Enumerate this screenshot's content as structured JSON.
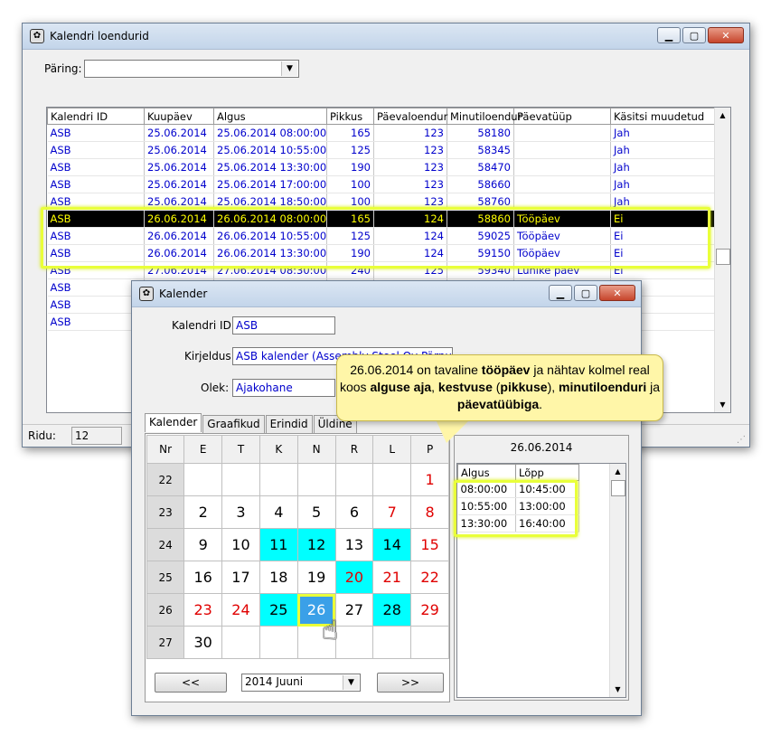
{
  "main_window": {
    "title": "Kalendri loendurid",
    "query_label": "Päring:",
    "query_value": "",
    "columns": [
      "Kalendri ID",
      "Kuupäev",
      "Algus",
      "Pikkus",
      "Päevaloendur",
      "Minutiloendur",
      "Päevatüüp",
      "Käsitsi muudetud"
    ],
    "rows": [
      [
        "ASB",
        "25.06.2014",
        "25.06.2014 08:00:00",
        "165",
        "123",
        "58180",
        "",
        "Jah"
      ],
      [
        "ASB",
        "25.06.2014",
        "25.06.2014 10:55:00",
        "125",
        "123",
        "58345",
        "",
        "Jah"
      ],
      [
        "ASB",
        "25.06.2014",
        "25.06.2014 13:30:00",
        "190",
        "123",
        "58470",
        "",
        "Jah"
      ],
      [
        "ASB",
        "25.06.2014",
        "25.06.2014 17:00:00",
        "100",
        "123",
        "58660",
        "",
        "Jah"
      ],
      [
        "ASB",
        "25.06.2014",
        "25.06.2014 18:50:00",
        "100",
        "123",
        "58760",
        "",
        "Jah"
      ],
      [
        "ASB",
        "26.06.2014",
        "26.06.2014 08:00:00",
        "165",
        "124",
        "58860",
        "Tööpäev",
        "Ei"
      ],
      [
        "ASB",
        "26.06.2014",
        "26.06.2014 10:55:00",
        "125",
        "124",
        "59025",
        "Tööpäev",
        "Ei"
      ],
      [
        "ASB",
        "26.06.2014",
        "26.06.2014 13:30:00",
        "190",
        "124",
        "59150",
        "Tööpäev",
        "Ei"
      ],
      [
        "ASB",
        "27.06.2014",
        "27.06.2014 08:30:00",
        "240",
        "125",
        "59340",
        "Lühike päev",
        "Ei"
      ],
      [
        "ASB",
        "",
        "",
        "",
        "",
        "",
        "",
        ""
      ],
      [
        "ASB",
        "",
        "",
        "",
        "",
        "",
        "",
        ""
      ],
      [
        "ASB",
        "",
        "",
        "",
        "",
        "",
        "",
        ""
      ]
    ],
    "rows_label": "Ridu:",
    "rows_count": "12"
  },
  "calendar_window": {
    "title": "Kalender",
    "id_label": "Kalendri ID:",
    "id_value": "ASB",
    "desc_label": "Kirjeldus:",
    "desc_value": "ASB kalender (Assembly Steel Oy Pärnu)",
    "status_label": "Olek:",
    "status_value": "Ajakohane",
    "tabs": [
      "Kalender",
      "Graafikud",
      "Erindid",
      "Üldine"
    ],
    "weekday_headers": [
      "Nr",
      "E",
      "T",
      "K",
      "N",
      "R",
      "L",
      "P"
    ],
    "weeks": [
      {
        "nr": "22",
        "days": [
          "",
          "",
          "",
          "",
          "",
          "",
          "1"
        ]
      },
      {
        "nr": "23",
        "days": [
          "2",
          "3",
          "4",
          "5",
          "6",
          "7",
          "8"
        ]
      },
      {
        "nr": "24",
        "days": [
          "9",
          "10",
          "11",
          "12",
          "13",
          "14",
          "15"
        ]
      },
      {
        "nr": "25",
        "days": [
          "16",
          "17",
          "18",
          "19",
          "20",
          "21",
          "22"
        ]
      },
      {
        "nr": "26",
        "days": [
          "23",
          "24",
          "25",
          "26",
          "27",
          "28",
          "29"
        ]
      },
      {
        "nr": "27",
        "days": [
          "30",
          "",
          "",
          "",
          "",
          "",
          ""
        ]
      }
    ],
    "prev_label": "<<",
    "next_label": ">>",
    "month_value": "2014 Juuni",
    "selected_date": "26.06.2014",
    "interval_columns": [
      "Algus",
      "Lõpp"
    ],
    "intervals": [
      [
        "08:00:00",
        "10:45:00"
      ],
      [
        "10:55:00",
        "13:00:00"
      ],
      [
        "13:30:00",
        "16:40:00"
      ]
    ]
  },
  "callout": {
    "t1": "26.06.2014 on tavaline ",
    "b1": "tööpäev",
    "t2": " ja nähtav kolmel real koos ",
    "b2": "alguse aja",
    "t3": ", ",
    "b3": "kestvuse",
    "t4": " (",
    "b4": "pikkuse",
    "t5": "), ",
    "b5": "minutiloenduri",
    "t6": " ja ",
    "b6": "päevatüübiga",
    "t7": "."
  },
  "colors": {
    "highlight": "#e9ff3a",
    "cyan_day": "#00ffff",
    "selected_day": "#3aa0e8",
    "weekend": "#e00000"
  }
}
